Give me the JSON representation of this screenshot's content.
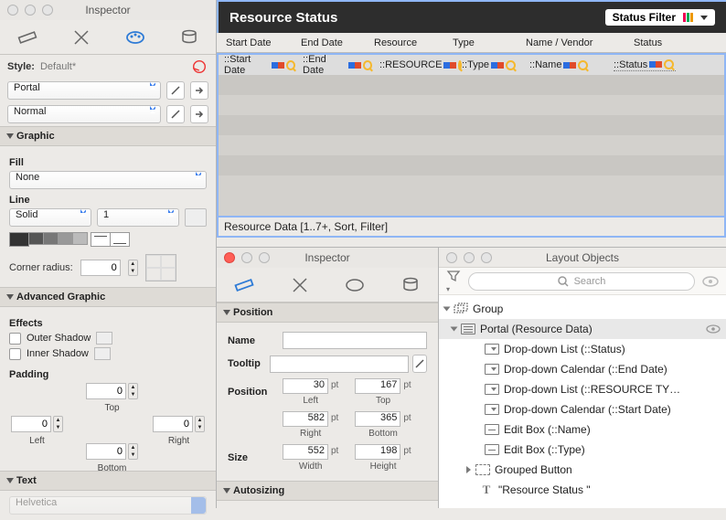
{
  "left_inspector": {
    "title": "Inspector",
    "style_label": "Style:",
    "style_default_caption": "Default*",
    "style_select1": "Portal",
    "style_select2": "Normal",
    "sections": {
      "graphic": "Graphic",
      "fill_label": "Fill",
      "fill_value": "None",
      "line_label": "Line",
      "line_type": "Solid",
      "line_width": "1",
      "corner_radius_label": "Corner radius:",
      "corner_radius_val": "0",
      "adv_graphic": "Advanced Graphic",
      "effects_label": "Effects",
      "outer_shadow": "Outer Shadow",
      "inner_shadow": "Inner Shadow",
      "padding_label": "Padding",
      "pad_top": "0",
      "pad_top_cap": "Top",
      "pad_left": "0",
      "pad_left_cap": "Left",
      "pad_right": "0",
      "pad_right_cap": "Right",
      "pad_bottom": "0",
      "pad_bottom_cap": "Bottom",
      "text_section": "Text",
      "font_value": "Helvetica"
    }
  },
  "layout": {
    "title": "Resource Status",
    "status_filter": "Status Filter",
    "columns": {
      "start": "Start Date",
      "end": "End Date",
      "resource": "Resource",
      "type": "Type",
      "name": "Name / Vendor",
      "status": "Status"
    },
    "fields": {
      "start": "::Start Date",
      "end": "::End Date",
      "resource": "::RESOURCE",
      "type": "::Type",
      "name": "::Name",
      "status": "::Status"
    },
    "portal_footer": "Resource Data [1..7+, Sort, Filter]"
  },
  "mid_inspector": {
    "title": "Inspector",
    "section_position": "Position",
    "name_label": "Name",
    "tooltip_label": "Tooltip",
    "position_label": "Position",
    "size_label": "Size",
    "pos_left": "30",
    "pos_left_cap": "Left",
    "unit": "pt",
    "pos_top": "167",
    "pos_top_cap": "Top",
    "pos_right": "582",
    "pos_right_cap": "Right",
    "pos_bottom": "365",
    "pos_bottom_cap": "Bottom",
    "size_w": "552",
    "size_w_cap": "Width",
    "size_h": "198",
    "size_h_cap": "Height",
    "section_autosizing": "Autosizing"
  },
  "layout_objects": {
    "title": "Layout Objects",
    "search_placeholder": "Search",
    "tree": {
      "group": "Group",
      "portal": "Portal (Resource Data)",
      "items": [
        "Drop-down List (::Status)",
        "Drop-down Calendar (::End Date)",
        "Drop-down List (::RESOURCE TY…",
        "Drop-down Calendar (::Start Date)",
        "Edit Box (::Name)",
        "Edit Box (::Type)"
      ],
      "grouped_button": "Grouped Button",
      "resource_status_text": "\"Resource Status \""
    }
  }
}
